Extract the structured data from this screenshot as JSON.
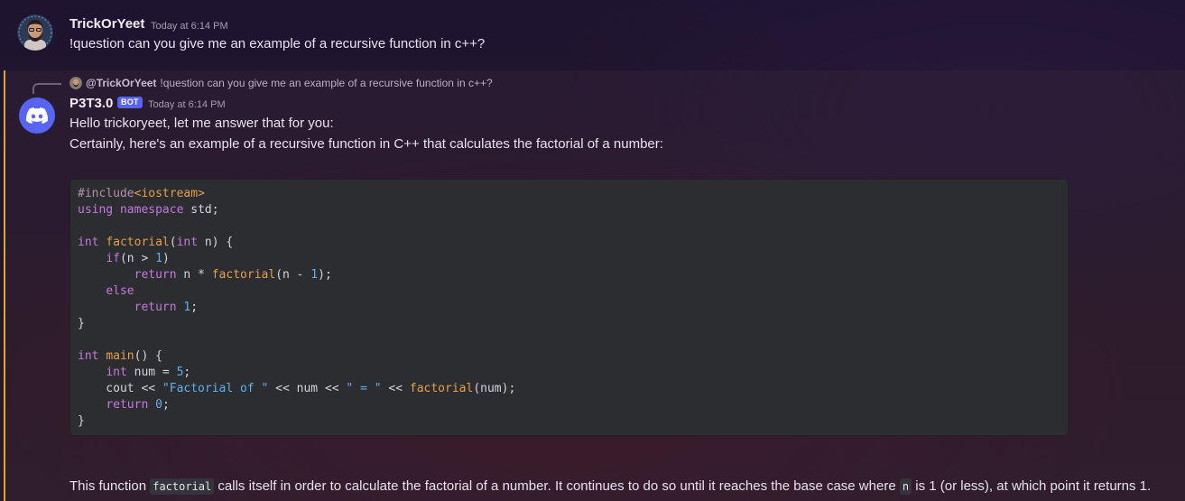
{
  "messages": [
    {
      "author": "TrickOrYeet",
      "timestamp": "Today at 6:14 PM",
      "content": "!question can you give me an example of a recursive function in c++?"
    },
    {
      "reply": {
        "author": "@TrickOrYeet",
        "text": "!question can you give me an example of a recursive function in c++?"
      },
      "author": "P3T3.0",
      "badge": "BOT",
      "timestamp": "Today at 6:14 PM",
      "line1": "Hello trickoryeet, let me answer that for you:",
      "line2": "Certainly, here's an example of a recursive function in C++ that calculates the factorial of a number:",
      "code": {
        "language": "cpp",
        "lines": [
          "#include<iostream>",
          "using namespace std;",
          "",
          "int factorial(int n) {",
          "    if(n > 1)",
          "        return n * factorial(n - 1);",
          "    else",
          "        return 1;",
          "}",
          "",
          "int main() {",
          "    int num = 5;",
          "    cout << \"Factorial of \" << num << \" = \" << factorial(num);",
          "    return 0;",
          "}"
        ]
      },
      "explanation": {
        "part1": "This function ",
        "code1": "factorial",
        "part2": " calls itself in order to calculate the factorial of a number. It continues to do so until it reaches the base case where ",
        "code2": "n",
        "part3": " is 1 (or less), at which point it returns 1."
      }
    }
  ],
  "colors": {
    "mention_bar": "#d7a542",
    "bot_badge": "#5865f2",
    "code_background": "#2b2d31"
  },
  "icons": {
    "bot_avatar": "discord-logo-icon",
    "user_avatar": "bearded-man-avatar"
  }
}
